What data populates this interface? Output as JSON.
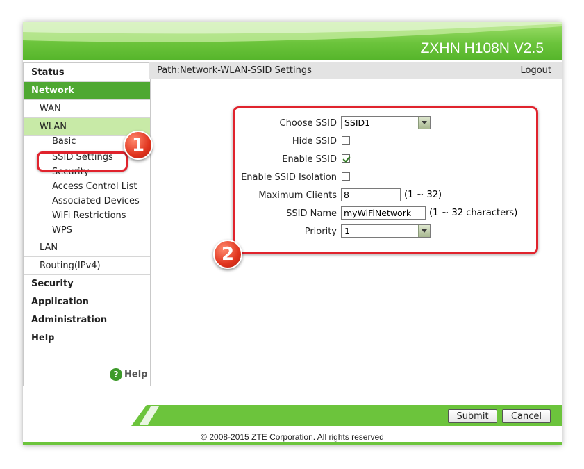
{
  "header": {
    "product_title": "ZXHN H108N V2.5"
  },
  "sidebar": {
    "status": "Status",
    "network": "Network",
    "wan": "WAN",
    "wlan": "WLAN",
    "basic": "Basic",
    "ssid_settings": "SSID Settings",
    "security_wlan": "Security",
    "acl": "Access Control List",
    "associated": "Associated Devices",
    "wifi_restrictions": "WiFi Restrictions",
    "wps": "WPS",
    "lan": "LAN",
    "routing": "Routing(IPv4)",
    "security": "Security",
    "application": "Application",
    "administration": "Administration",
    "help": "Help",
    "help_link": "Help",
    "help_icon": "?"
  },
  "pathbar": {
    "path": "Path:Network-WLAN-SSID Settings",
    "logout": "Logout"
  },
  "form": {
    "choose_ssid_label": "Choose SSID",
    "choose_ssid_value": "SSID1",
    "hide_ssid_label": "Hide SSID",
    "hide_ssid_checked": false,
    "enable_ssid_label": "Enable SSID",
    "enable_ssid_checked": true,
    "isolation_label": "Enable SSID Isolation",
    "isolation_checked": false,
    "max_clients_label": "Maximum Clients",
    "max_clients_value": "8",
    "max_clients_hint": "(1 ~ 32)",
    "ssid_name_label": "SSID Name",
    "ssid_name_value": "myWiFiNetwork",
    "ssid_name_hint": "(1 ~ 32 characters)",
    "priority_label": "Priority",
    "priority_value": "1"
  },
  "annotations": {
    "badge1": "1",
    "badge2": "2"
  },
  "footer": {
    "submit": "Submit",
    "cancel": "Cancel",
    "copyright": "© 2008-2015 ZTE Corporation. All rights reserved"
  },
  "colors": {
    "accent_green": "#4fa832",
    "highlight_red": "#e0232d"
  }
}
